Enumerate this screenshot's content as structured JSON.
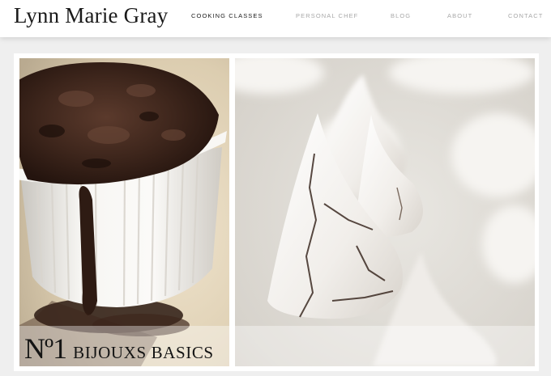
{
  "header": {
    "logo": "Lynn Marie Gray",
    "nav": [
      {
        "label": "COOKING CLASSES",
        "active": true
      },
      {
        "label": "PERSONAL CHEF",
        "active": false
      },
      {
        "label": "BLOG",
        "active": false
      },
      {
        "label": "ABOUT",
        "active": false
      },
      {
        "label": "CONTACT",
        "active": false
      }
    ]
  },
  "feature": {
    "number": "Nº1",
    "title": "BIJOUXS BASICS"
  },
  "colors": {
    "nav_active": "#1a1a1a",
    "nav_inactive": "#a8a8a8",
    "page_bg": "#efefef",
    "chocolate": "#3a2219"
  }
}
